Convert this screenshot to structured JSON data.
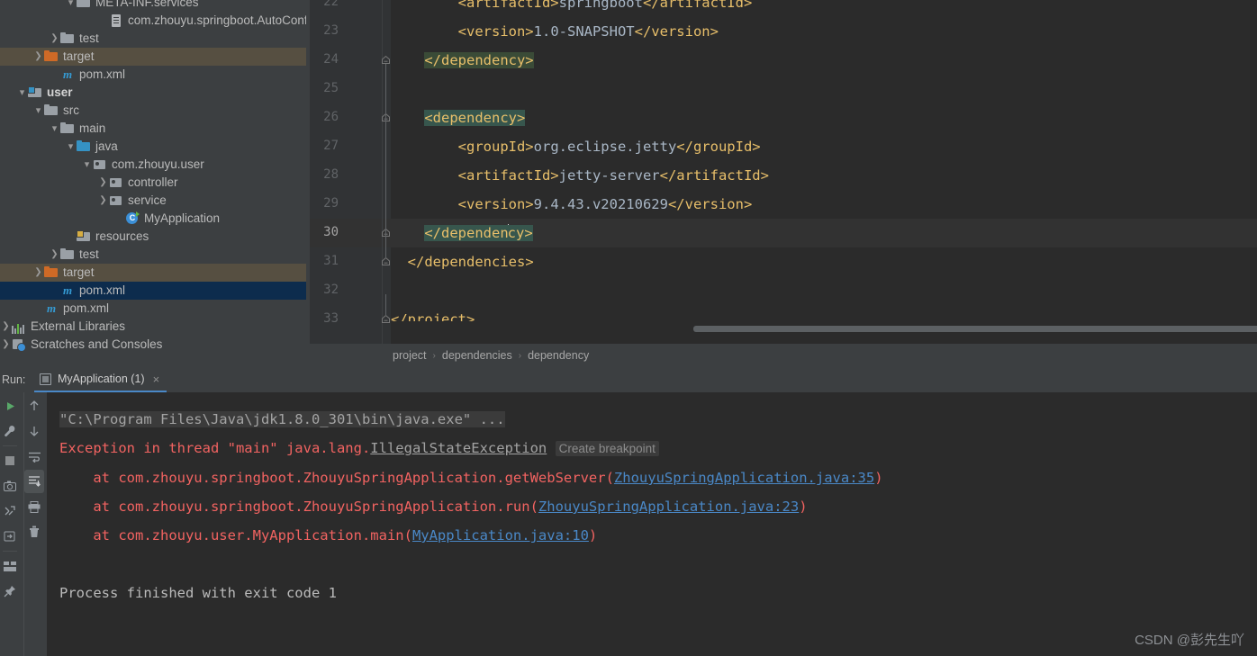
{
  "project_tree": {
    "name": "Project",
    "items": [
      {
        "indent": 4,
        "arrow": "down",
        "icon": "folder-icon",
        "label": "META-INF.services",
        "state": "partial-top"
      },
      {
        "indent": 6,
        "arrow": "none",
        "icon": "file-icon",
        "label": "com.zhouyu.springboot.AutoConfig",
        "truncated": true
      },
      {
        "indent": 3,
        "arrow": "right",
        "icon": "folder-icon",
        "label": "test"
      },
      {
        "indent": 2,
        "arrow": "right",
        "icon": "folder-orange-icon",
        "label": "target",
        "highlight": "target"
      },
      {
        "indent": 3,
        "arrow": "none",
        "icon": "maven-icon",
        "label": "pom.xml"
      },
      {
        "indent": 1,
        "arrow": "down",
        "icon": "module-icon",
        "label": "user",
        "bold": true
      },
      {
        "indent": 2,
        "arrow": "down",
        "icon": "folder-icon",
        "label": "src"
      },
      {
        "indent": 3,
        "arrow": "down",
        "icon": "folder-icon",
        "label": "main"
      },
      {
        "indent": 4,
        "arrow": "down",
        "icon": "folder-blue-icon",
        "label": "java"
      },
      {
        "indent": 5,
        "arrow": "down",
        "icon": "package-icon",
        "label": "com.zhouyu.user"
      },
      {
        "indent": 6,
        "arrow": "right",
        "icon": "package-icon",
        "label": "controller"
      },
      {
        "indent": 6,
        "arrow": "right",
        "icon": "package-icon",
        "label": "service"
      },
      {
        "indent": 7,
        "arrow": "none",
        "icon": "java-class-icon",
        "label": "MyApplication"
      },
      {
        "indent": 4,
        "arrow": "none",
        "icon": "resources-icon",
        "label": "resources"
      },
      {
        "indent": 3,
        "arrow": "right",
        "icon": "folder-icon",
        "label": "test"
      },
      {
        "indent": 2,
        "arrow": "right",
        "icon": "folder-orange-icon",
        "label": "target",
        "highlight": "target"
      },
      {
        "indent": 3,
        "arrow": "none",
        "icon": "maven-icon",
        "label": "pom.xml",
        "highlight": "selected"
      },
      {
        "indent": 2,
        "arrow": "none",
        "icon": "maven-icon",
        "label": "pom.xml"
      },
      {
        "indent": 0,
        "arrow": "right",
        "icon": "external-libraries-icon",
        "label": "External Libraries"
      },
      {
        "indent": 0,
        "arrow": "right",
        "icon": "scratches-icon",
        "label": "Scratches and Consoles"
      }
    ]
  },
  "editor": {
    "file": "pom.xml",
    "lines": [
      {
        "number": "22",
        "partial": true,
        "segments": [
          {
            "text": "        ",
            "style": "plain"
          },
          {
            "text": "<artifactId>",
            "style": "tag"
          },
          {
            "text": "springboot",
            "style": "text"
          },
          {
            "text": "</artifactId>",
            "style": "tag"
          }
        ]
      },
      {
        "number": "23",
        "segments": [
          {
            "text": "        ",
            "style": "plain"
          },
          {
            "text": "<version>",
            "style": "tag"
          },
          {
            "text": "1.0-SNAPSHOT",
            "style": "text"
          },
          {
            "text": "</version>",
            "style": "tag"
          }
        ]
      },
      {
        "number": "24",
        "fold": true,
        "segments": [
          {
            "text": "    ",
            "style": "plain"
          },
          {
            "text": "</dependency>",
            "style": "tag",
            "highlight": "green"
          }
        ]
      },
      {
        "number": "25",
        "segments": []
      },
      {
        "number": "26",
        "fold": true,
        "segments": [
          {
            "text": "    ",
            "style": "plain"
          },
          {
            "text": "<dependency>",
            "style": "tag",
            "highlight": "teal"
          }
        ]
      },
      {
        "number": "27",
        "segments": [
          {
            "text": "        ",
            "style": "plain"
          },
          {
            "text": "<groupId>",
            "style": "tag"
          },
          {
            "text": "org.eclipse.jetty",
            "style": "text"
          },
          {
            "text": "</groupId>",
            "style": "tag"
          }
        ]
      },
      {
        "number": "28",
        "segments": [
          {
            "text": "        ",
            "style": "plain"
          },
          {
            "text": "<artifactId>",
            "style": "tag"
          },
          {
            "text": "jetty-server",
            "style": "text"
          },
          {
            "text": "</artifactId>",
            "style": "tag"
          }
        ]
      },
      {
        "number": "29",
        "segments": [
          {
            "text": "        ",
            "style": "plain"
          },
          {
            "text": "<version>",
            "style": "tag"
          },
          {
            "text": "9.4.43.v20210629",
            "style": "text"
          },
          {
            "text": "</version>",
            "style": "tag"
          }
        ]
      },
      {
        "number": "30",
        "current": true,
        "fold": true,
        "segments": [
          {
            "text": "    ",
            "style": "plain"
          },
          {
            "text": "</dependen",
            "style": "tag",
            "highlight": "teal"
          },
          {
            "text": "CARET",
            "style": "caret"
          },
          {
            "text": "cy>",
            "style": "tag",
            "highlight": "teal"
          }
        ]
      },
      {
        "number": "31",
        "fold": true,
        "segments": [
          {
            "text": "  ",
            "style": "plain"
          },
          {
            "text": "</dependencies>",
            "style": "tag"
          }
        ]
      },
      {
        "number": "32",
        "segments": []
      },
      {
        "number": "33",
        "fold": true,
        "segments": [
          {
            "text": "</project>",
            "style": "tag"
          }
        ]
      }
    ]
  },
  "breadcrumb": {
    "items": [
      "project",
      "dependencies",
      "dependency"
    ],
    "separator": "›"
  },
  "run_panel": {
    "label": "Run:",
    "tab_title": "MyApplication (1)",
    "tab_close": "×",
    "toolbar_left": [
      {
        "name": "rerun-button",
        "icon": "play-icon"
      },
      {
        "name": "edit-configuration-button",
        "icon": "wrench-icon"
      },
      {
        "name": "stop-button",
        "icon": "stop-icon"
      },
      {
        "name": "screenshot-button",
        "icon": "camera-icon"
      },
      {
        "name": "dump-threads-button",
        "icon": "thread-dump-icon"
      },
      {
        "name": "resume-button",
        "icon": "resume-icon"
      },
      {
        "name": "layout-button",
        "icon": "layout-icon"
      },
      {
        "name": "pin-tab-button",
        "icon": "pin-icon"
      }
    ],
    "toolbar_right": [
      {
        "name": "up-stacktrace-button",
        "icon": "arrow-up-icon"
      },
      {
        "name": "down-stacktrace-button",
        "icon": "arrow-down-icon"
      },
      {
        "name": "soft-wrap-button",
        "icon": "soft-wrap-icon"
      },
      {
        "name": "scroll-to-end-button",
        "icon": "scroll-to-end-icon",
        "active": true
      },
      {
        "name": "print-button",
        "icon": "print-icon"
      },
      {
        "name": "clear-all-button",
        "icon": "trash-icon"
      }
    ],
    "console": {
      "lines": [
        {
          "type": "command",
          "segments": [
            {
              "text": "\"C:\\Program Files\\Java\\jdk1.8.0_301\\bin\\java.exe\" ...",
              "style": "cmd"
            }
          ]
        },
        {
          "type": "exception",
          "segments": [
            {
              "text": "Exception in thread \"main\" java.lang.",
              "style": "err"
            },
            {
              "text": "IllegalStateException",
              "style": "errlink"
            },
            {
              "text": " ",
              "style": "plain"
            },
            {
              "text": "Create breakpoint",
              "style": "breakpoint"
            }
          ]
        },
        {
          "type": "frame",
          "segments": [
            {
              "text": "    at com.zhouyu.springboot.ZhouyuSpringApplication.getWebServer(",
              "style": "err"
            },
            {
              "text": "ZhouyuSpringApplication.java:35",
              "style": "link"
            },
            {
              "text": ")",
              "style": "err"
            }
          ]
        },
        {
          "type": "frame",
          "segments": [
            {
              "text": "    at com.zhouyu.springboot.ZhouyuSpringApplication.run(",
              "style": "err"
            },
            {
              "text": "ZhouyuSpringApplication.java:23",
              "style": "link"
            },
            {
              "text": ")",
              "style": "err"
            }
          ]
        },
        {
          "type": "frame",
          "segments": [
            {
              "text": "    at com.zhouyu.user.MyApplication.main(",
              "style": "err"
            },
            {
              "text": "MyApplication.java:10",
              "style": "link"
            },
            {
              "text": ")",
              "style": "err"
            }
          ]
        },
        {
          "type": "blank",
          "segments": []
        },
        {
          "type": "output",
          "segments": [
            {
              "text": "Process finished with exit code 1",
              "style": "out"
            }
          ]
        }
      ]
    }
  },
  "watermark": "CSDN @彭先生吖",
  "colors": {
    "editor_bg": "#2b2b2b",
    "panel_bg": "#3c3f41",
    "gutter_bg": "#313335",
    "tag": "#e8bf6a",
    "text_value": "#a9b7c6",
    "error": "#f26361",
    "link": "#4a88c7",
    "selection_blue": "#0d2c4d",
    "selection_target": "#564f41",
    "accent": "#4a88c7"
  }
}
